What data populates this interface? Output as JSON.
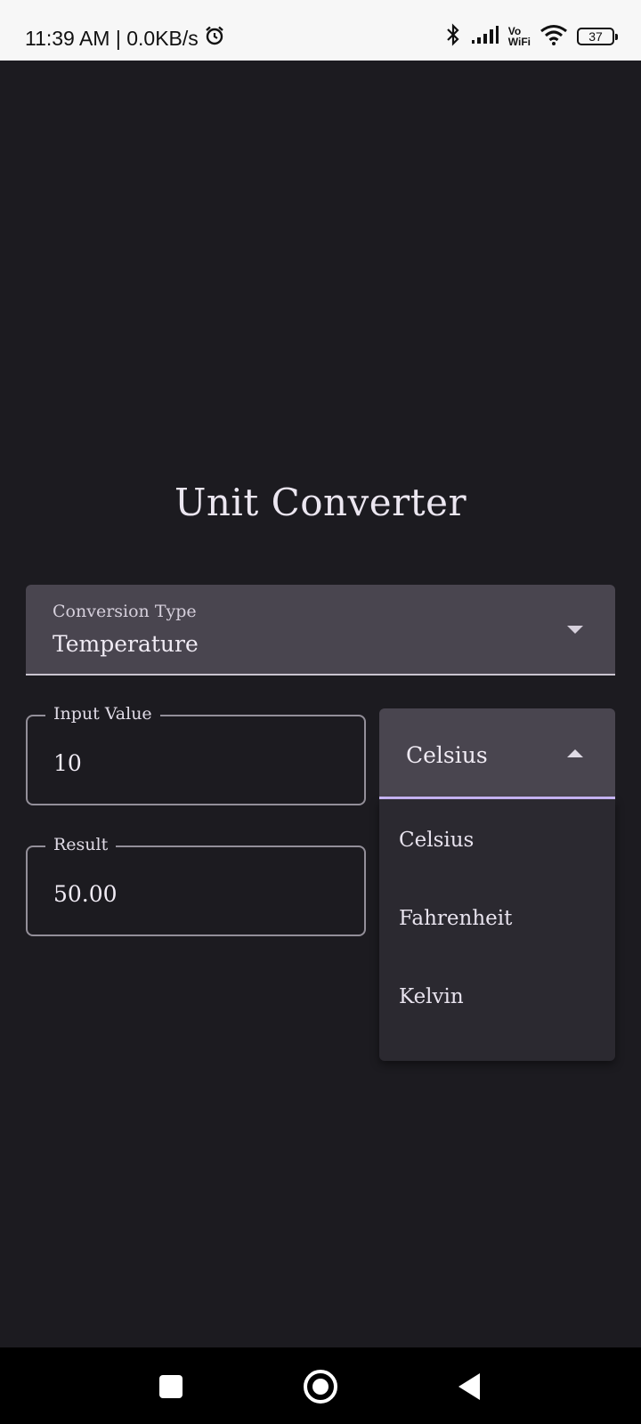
{
  "status_bar": {
    "time_speed": "11:39 AM | 0.0KB/s",
    "vo": "Vo",
    "wifi_label": "WiFi",
    "battery": "37",
    "icons": [
      "alarm-icon",
      "bluetooth-icon",
      "signal-icon",
      "wifi-icon"
    ]
  },
  "app": {
    "title": "Unit Converter"
  },
  "conversion_type": {
    "label": "Conversion Type",
    "value": "Temperature"
  },
  "input": {
    "label": "Input Value",
    "value": "10"
  },
  "result": {
    "label": "Result",
    "value": "50.00"
  },
  "unit_select": {
    "value": "Celsius",
    "options": [
      "Celsius",
      "Fahrenheit",
      "Kelvin"
    ]
  },
  "colors": {
    "background": "#1c1b20",
    "field_fill": "#49454f",
    "menu_fill": "#2b2930",
    "accent": "#cfbcff"
  }
}
